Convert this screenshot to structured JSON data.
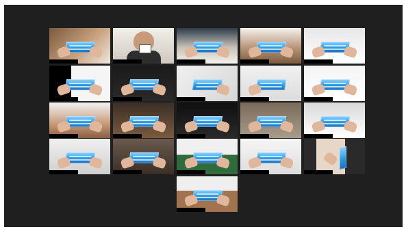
{
  "meeting": {
    "participant_tiles": [
      {
        "id": "p01"
      },
      {
        "id": "p02",
        "active": true
      },
      {
        "id": "p03"
      },
      {
        "id": "p04"
      },
      {
        "id": "p05"
      },
      {
        "id": "p06"
      },
      {
        "id": "p07"
      },
      {
        "id": "p08"
      },
      {
        "id": "p09"
      },
      {
        "id": "p10"
      },
      {
        "id": "p11"
      },
      {
        "id": "p12"
      },
      {
        "id": "p13"
      },
      {
        "id": "p14"
      },
      {
        "id": "p15"
      },
      {
        "id": "p16"
      },
      {
        "id": "p17"
      },
      {
        "id": "p18"
      },
      {
        "id": "p19"
      },
      {
        "id": "p20"
      },
      {
        "id": "p21"
      }
    ],
    "active_speaker_outline_color": "#d7e05b",
    "gallery_background": "#1f1f1f"
  }
}
